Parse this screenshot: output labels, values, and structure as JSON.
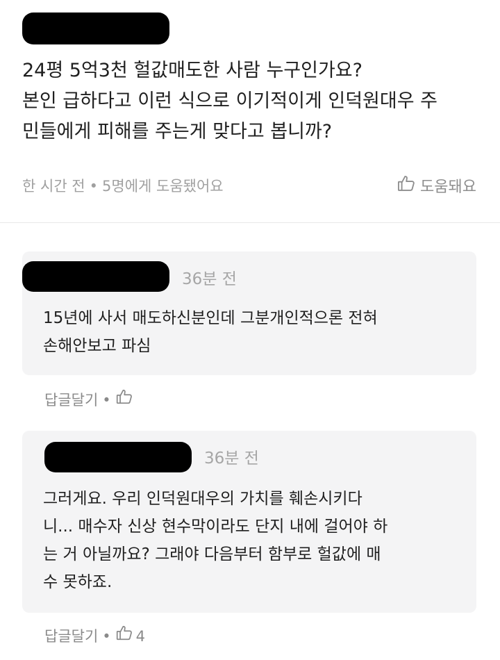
{
  "post": {
    "lines": [
      "24평 5억3천 헐값매도한 사람 누구인가요?",
      "본인 급하다고 이런 식으로 이기적이게 인덕원대우 주",
      "민들에게 피해를 주는게 맞다고 봅니까?"
    ],
    "time": "한 시간 전",
    "separator": "•",
    "helpful_count": "5명에게 도움됐어요",
    "helpful_label": "도움돼요"
  },
  "comments": [
    {
      "time": "36분 전",
      "lines": [
        "15년에 사서 매도하신분인데 그분개인적으론 전혀",
        "손해안보고 파심"
      ],
      "reply_label": "답글달기",
      "separator": "•",
      "like_count": ""
    },
    {
      "time": "36분 전",
      "lines": [
        "그러게요. 우리 인덕원대우의 가치를 훼손시키다",
        "니... 매수자 신상 현수막이라도 단지 내에 걸어야 하",
        "는 거 아닐까요? 그래야 다음부터 함부로 헐값에 매",
        "수 못하죠."
      ],
      "reply_label": "답글달기",
      "separator": "•",
      "like_count": "4"
    }
  ]
}
